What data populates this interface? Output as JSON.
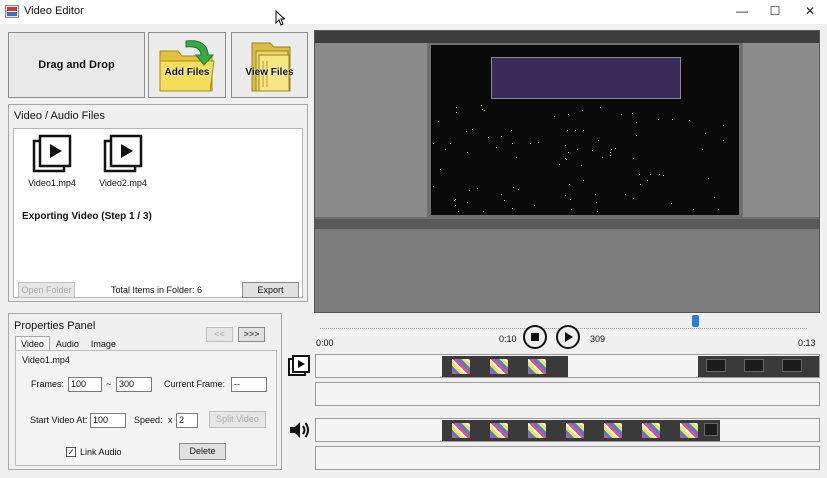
{
  "window": {
    "title": "Video Editor",
    "minimize_glyph": "—",
    "maximize_glyph": "☐",
    "close_glyph": "✕"
  },
  "toolbar": {
    "drag_drop_label": "Drag and Drop",
    "add_files_label": "Add Files",
    "view_files_label": "View Files"
  },
  "files_panel": {
    "title": "Video / Audio Files",
    "files": [
      {
        "name": "Video1.mp4",
        "icon": "video-file-icon"
      },
      {
        "name": "Video2.mp4",
        "icon": "video-file-icon"
      }
    ],
    "status": "Exporting Video (Step 1 / 3)",
    "total_items": "Total Items in Folder: 6",
    "open_folder_label": "Open Folder",
    "export_label": "Export"
  },
  "properties": {
    "title": "Properties Panel",
    "prev_label": "<<",
    "next_label": ">>>",
    "tabs": [
      "Video",
      "Audio",
      "Image"
    ],
    "active_tab": "Video",
    "file_name": "Video1.mp4",
    "frames_label": "Frames:",
    "frames_from": "100",
    "frames_sep": "~",
    "frames_to": "300",
    "current_frame_label": "Current Frame:",
    "current_frame": "--",
    "start_at_label": "Start Video At:",
    "start_at": "100",
    "speed_label": "Speed:",
    "speed_prefix": "x",
    "speed": "2",
    "split_label": "Split Video",
    "link_audio_label": "Link Audio",
    "link_audio_checked": true,
    "check_glyph": "✓",
    "delete_label": "Delete"
  },
  "playback": {
    "start_time": "0:00",
    "current_time": "0:10",
    "frame_number": "309",
    "end_time": "0:13",
    "progress": 0.77
  },
  "colors": {
    "accent": "#2a7dd1",
    "folder": "#f2d64b",
    "arrow": "#3aa845"
  }
}
